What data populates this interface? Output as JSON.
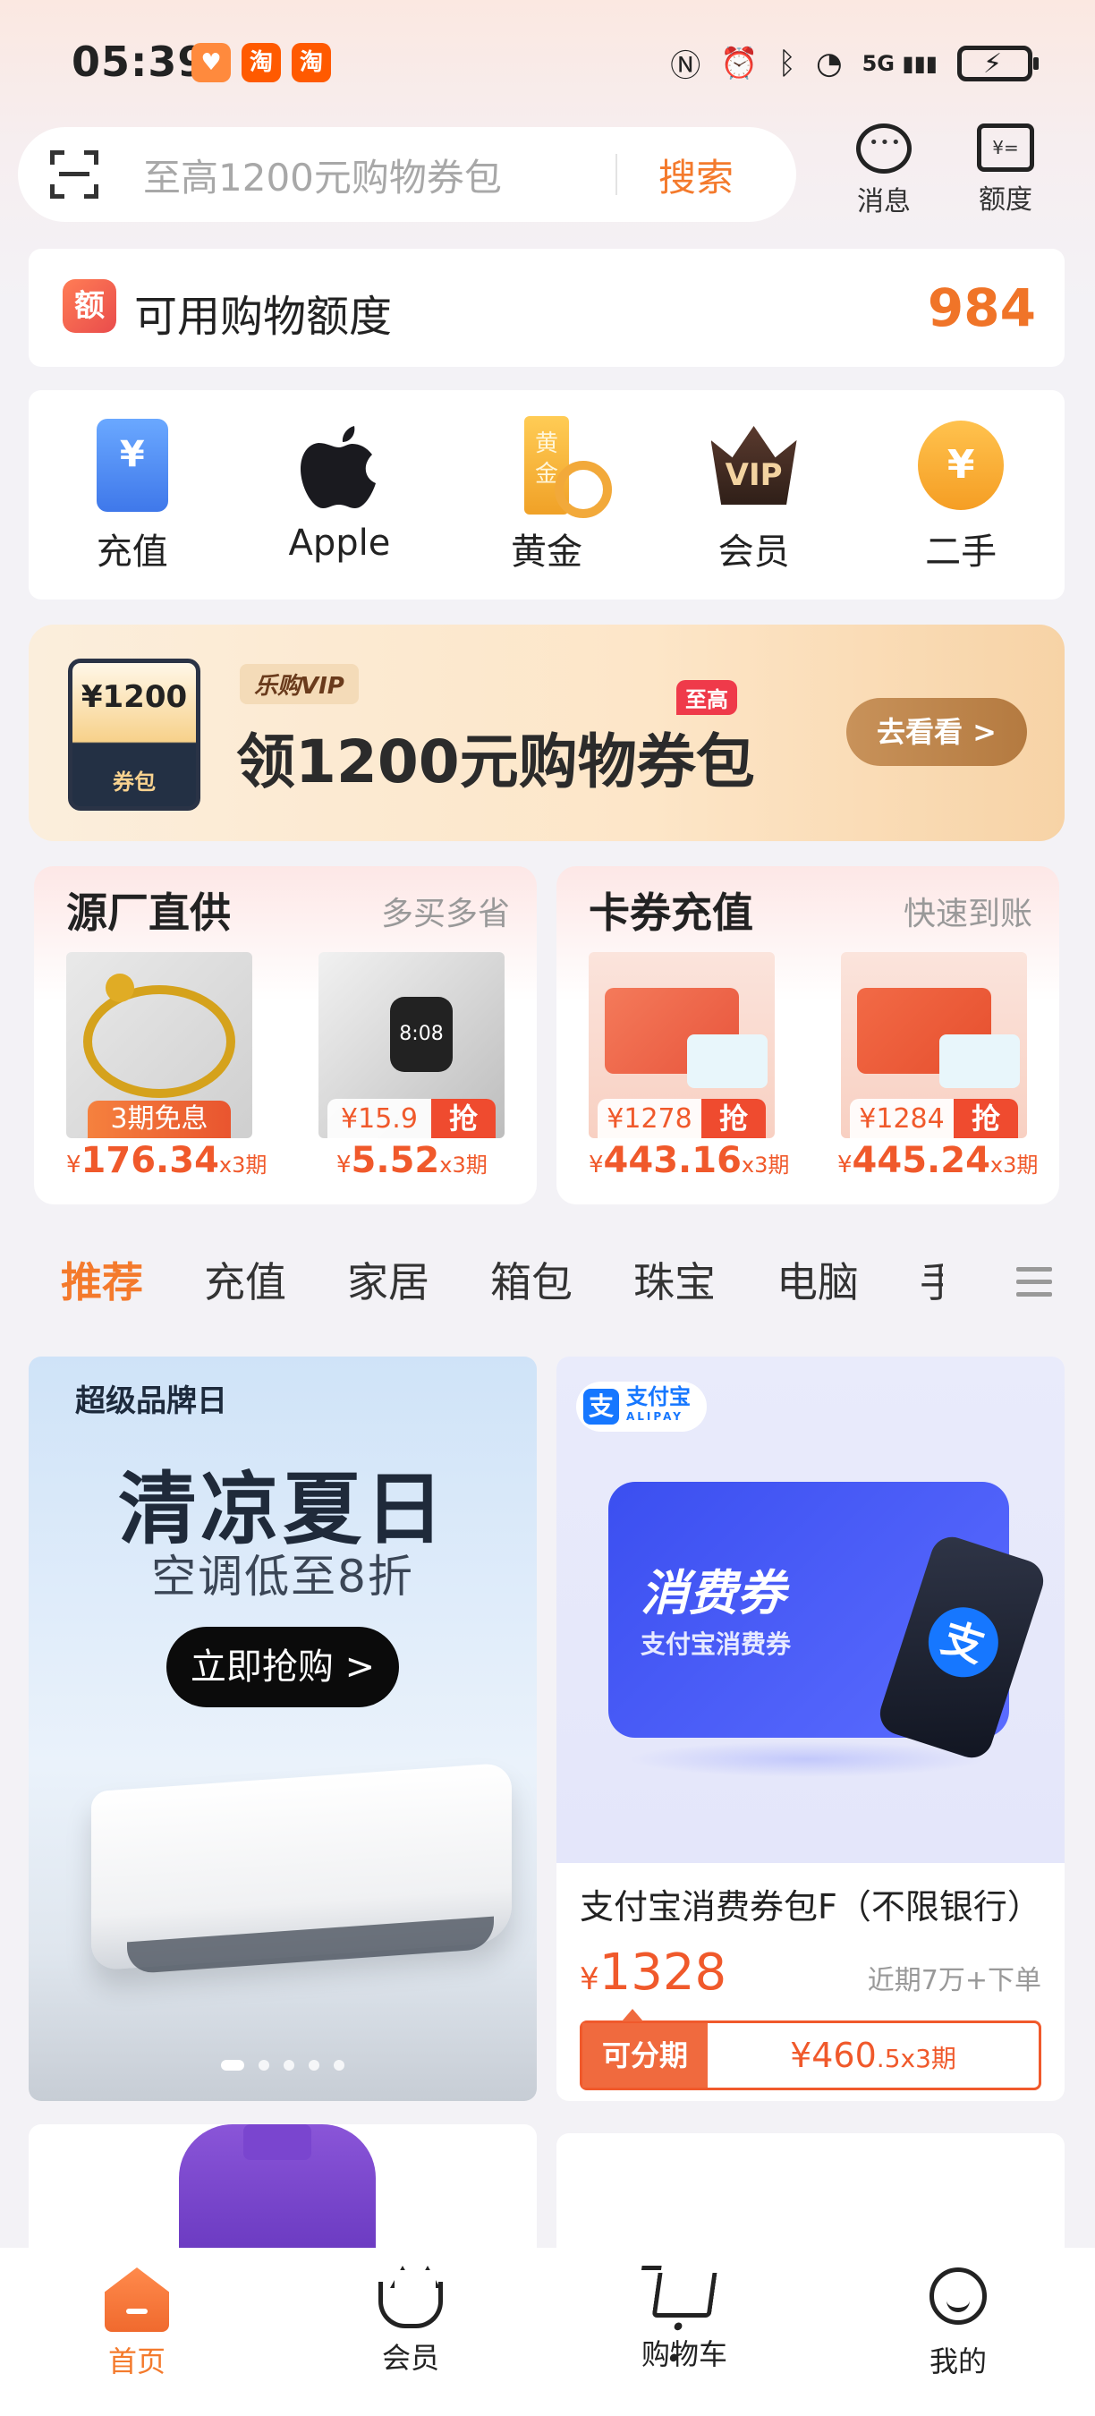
{
  "status_bar": {
    "time": "05:39",
    "apps": [
      "heart-app",
      "taobao-app",
      "taobao-app"
    ],
    "network": "5G"
  },
  "search": {
    "placeholder": "至高1200元购物券包",
    "button": "搜索"
  },
  "header_icons": {
    "messages": "消息",
    "quota": "额度"
  },
  "credit": {
    "icon_text": "额",
    "label": "可用购物额度",
    "value": "984"
  },
  "quick_grid": [
    {
      "label": "充值",
      "icon": "recharge-icon",
      "glyph": "¥"
    },
    {
      "label": "Apple",
      "icon": "apple-icon",
      "glyph": ""
    },
    {
      "label": "黄金",
      "icon": "gold-icon",
      "glyph": "黄金"
    },
    {
      "label": "会员",
      "icon": "vip-icon",
      "glyph": "VIP"
    },
    {
      "label": "二手",
      "icon": "secondhand-icon",
      "glyph": "¥"
    }
  ],
  "banner": {
    "coupon_amount": "¥1200",
    "coupon_tag": "券包",
    "vip_tag": "乐购VIP",
    "badge": "至高",
    "title": "领1200元购物券包",
    "button": "去看看 >"
  },
  "promo_cards": [
    {
      "title": "源厂直供",
      "subtitle": "多买多省",
      "items": [
        {
          "badge": "3期免息",
          "price_symbol": "¥",
          "price": "176.34",
          "period": "x3期",
          "tag_price": "",
          "tag_action": ""
        },
        {
          "badge": "",
          "price_symbol": "¥",
          "price": "5.52",
          "period": "x3期",
          "tag_price": "¥15.9",
          "tag_action": "抢"
        }
      ]
    },
    {
      "title": "卡券充值",
      "subtitle": "快速到账",
      "items": [
        {
          "badge": "",
          "price_symbol": "¥",
          "price": "443.16",
          "period": "x3期",
          "tag_price": "¥1278",
          "tag_action": "抢"
        },
        {
          "badge": "",
          "price_symbol": "¥",
          "price": "445.24",
          "period": "x3期",
          "tag_price": "¥1284",
          "tag_action": "抢"
        }
      ]
    }
  ],
  "tabs": [
    "推荐",
    "充值",
    "家居",
    "箱包",
    "珠宝",
    "电脑",
    "手"
  ],
  "feed_left": {
    "brand": "超级品牌日",
    "headline": "清凉夏日",
    "sub": "空调低至8折",
    "cta": "立即抢购 >"
  },
  "feed_right": {
    "logo_text": "支付宝",
    "logo_sub": "ALIPAY",
    "logo_mark": "支",
    "coupon_title": "消费券",
    "coupon_sub": "支付宝消费券",
    "title": "支付宝消费券包F（不限银行）",
    "price_symbol": "¥",
    "price": "1328",
    "sales": "近期7万+下单",
    "installment_label": "可分期",
    "installment_value": "¥460",
    "installment_decimal": ".5x3期"
  },
  "bottom_nav": [
    {
      "label": "首页",
      "active": true
    },
    {
      "label": "会员",
      "active": false
    },
    {
      "label": "购物车",
      "active": false
    },
    {
      "label": "我的",
      "active": false
    }
  ],
  "colors": {
    "accent": "#f47a2c",
    "price": "#f0592b",
    "background": "#f3f2f6"
  }
}
